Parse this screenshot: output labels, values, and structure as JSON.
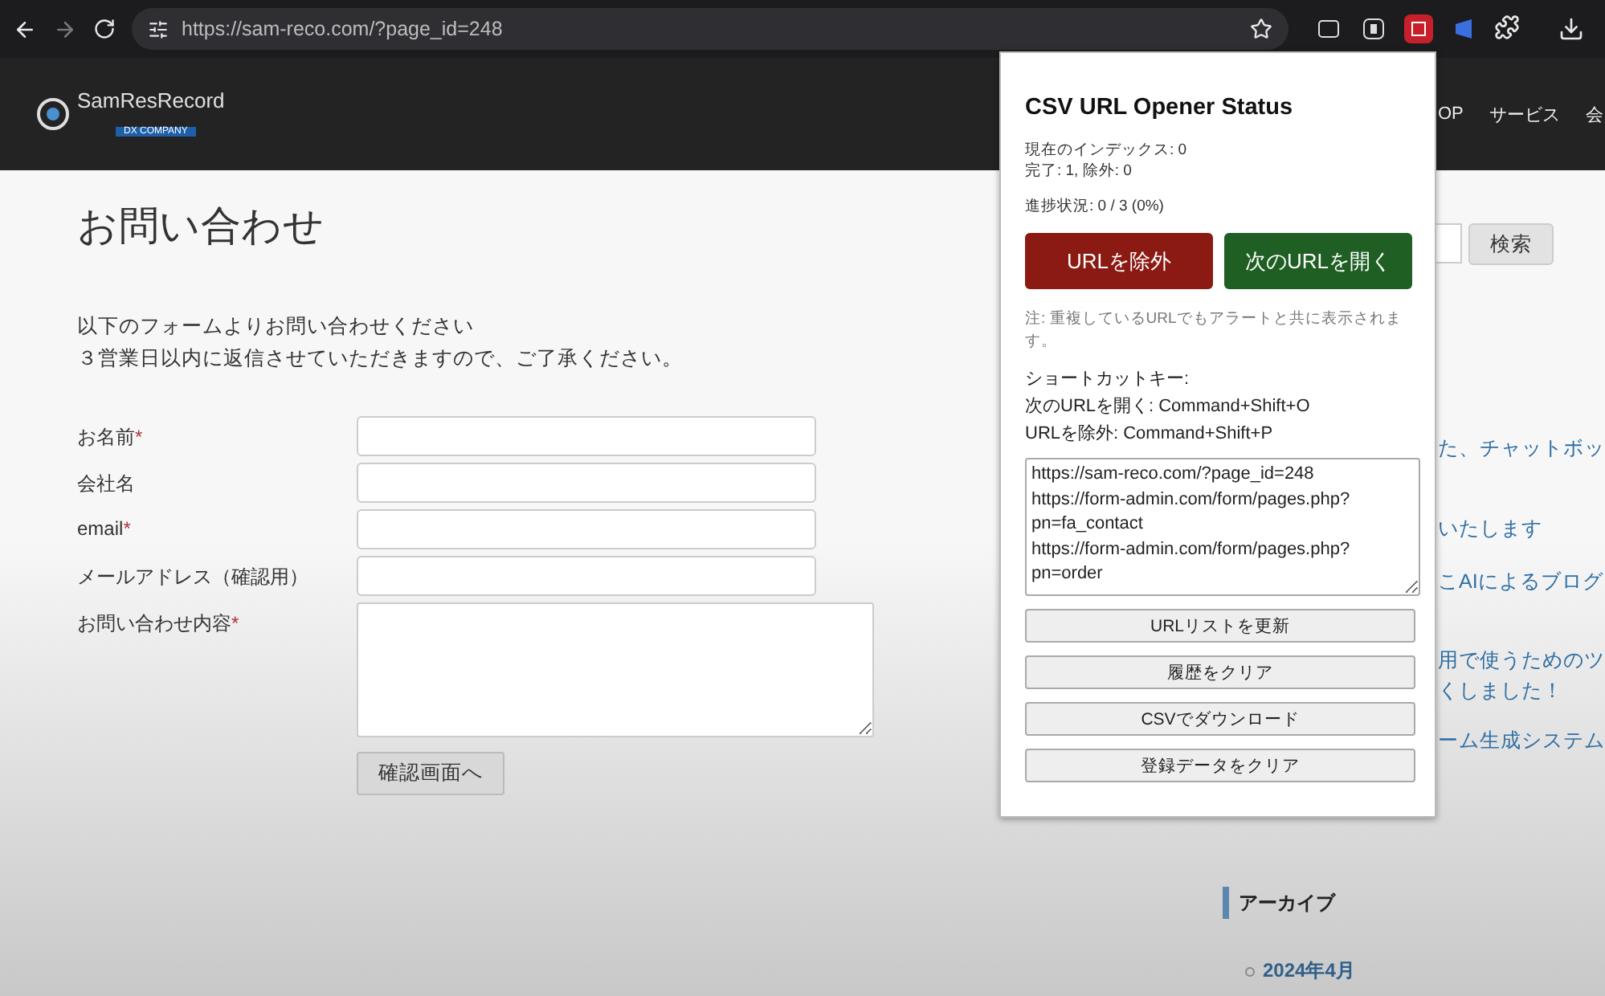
{
  "browser": {
    "url": "https://sam-reco.com/?page_id=248"
  },
  "site": {
    "logo": "SamResRecord",
    "logo_tag": "DX COMPANY",
    "nav": [
      "OP",
      "サービス",
      "会"
    ]
  },
  "page": {
    "title": "お問い合わせ",
    "intro": [
      "以下のフォームよりお問い合わせください",
      "３営業日以内に返信させていただきますので、ご了承ください。"
    ],
    "fields": [
      {
        "label": "お名前",
        "required": true,
        "kind": "input"
      },
      {
        "label": "会社名",
        "required": false,
        "kind": "input"
      },
      {
        "label": "email",
        "required": true,
        "kind": "input"
      },
      {
        "label": "メールアドレス（確認用）",
        "required": false,
        "kind": "input"
      },
      {
        "label": "お問い合わせ内容",
        "required": true,
        "kind": "textarea"
      }
    ],
    "required_mark": "*",
    "submit": "確認画面へ"
  },
  "sidebar": {
    "search_button": "検索",
    "links": [
      [
        "た、チャットボッ"
      ],
      [
        "いたします"
      ],
      [
        "こAIによるブログ"
      ],
      [
        "用で使うためのツ",
        "くしました！"
      ],
      [
        "ーム生成システム"
      ]
    ],
    "archive_heading": "アーカイブ",
    "archive_items": [
      "2024年4月"
    ]
  },
  "popup": {
    "title": "CSV URL Opener Status",
    "stats": [
      "現在のインデックス: 0",
      "完了: 1, 除外: 0"
    ],
    "progress": "進捗状況: 0 / 3 (0%)",
    "actions": [
      {
        "label": "URLを除外",
        "kind": "exclude"
      },
      {
        "label": "次のURLを開く",
        "kind": "open"
      }
    ],
    "note": "注: 重複しているURLでもアラートと共に表示されます。",
    "shortcuts_heading": "ショートカットキー:",
    "shortcuts": [
      "次のURLを開く: Command+Shift+O",
      "URLを除外: Command+Shift+P"
    ],
    "url_list": [
      "https://sam-reco.com/?page_id=248",
      "https://form-admin.com/form/pages.php?pn=fa_contact",
      "https://form-admin.com/form/pages.php?pn=order"
    ],
    "buttons": [
      "URLリストを更新",
      "履歴をクリア",
      "CSVでダウンロード",
      "登録データをクリア"
    ]
  }
}
